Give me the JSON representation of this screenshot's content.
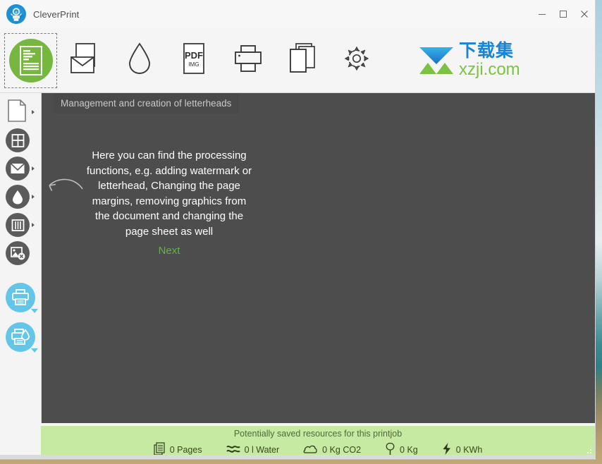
{
  "window": {
    "app_title": "CleverPrint",
    "logo_icon": "cleverprint-logo-icon",
    "controls": {
      "minimize": "–",
      "maximize": "□",
      "close": "✕"
    }
  },
  "toolbar": {
    "items": [
      {
        "name": "letterhead",
        "icon": "letterhead-document-icon",
        "selected": true
      },
      {
        "name": "envelope",
        "icon": "envelope-icon",
        "selected": false
      },
      {
        "name": "watermark",
        "icon": "water-drop-icon",
        "selected": false
      },
      {
        "name": "pdf-img",
        "icon": "pdf-img-icon",
        "label_main": "PDF",
        "label_sub": "IMG",
        "selected": false
      },
      {
        "name": "print",
        "icon": "printer-icon",
        "selected": false
      },
      {
        "name": "copies",
        "icon": "copy-pages-icon",
        "selected": false
      },
      {
        "name": "settings",
        "icon": "gear-icon",
        "selected": false
      }
    ],
    "brand": {
      "icon": "xzji-brand-logo",
      "cn_text": "下载集",
      "domain_text": "xzji.com"
    }
  },
  "sidebar": {
    "items": [
      {
        "name": "page",
        "icon": "page-outline-icon",
        "style": "plain",
        "arrow": true
      },
      {
        "name": "layout",
        "icon": "grid-window-icon",
        "style": "dark",
        "arrow": false
      },
      {
        "name": "envelope",
        "icon": "envelope-circle-icon",
        "style": "dark",
        "arrow": true
      },
      {
        "name": "watermark",
        "icon": "water-drop-circle-icon",
        "style": "dark",
        "arrow": true
      },
      {
        "name": "booklet",
        "icon": "booklet-columns-icon",
        "style": "dark",
        "arrow": true
      },
      {
        "name": "remove-graphics",
        "icon": "image-remove-icon",
        "style": "dark",
        "arrow": false
      },
      {
        "name": "print",
        "icon": "printer-blue-icon",
        "style": "blue",
        "caret": true
      },
      {
        "name": "eco-print",
        "icon": "printer-drop-blue-icon",
        "style": "blue",
        "caret": true
      }
    ]
  },
  "canvas": {
    "tooltip": "Management and creation of letterheads",
    "overlay_text": "Here you can find the processing functions, e.g. adding watermark or letterhead, Changing the page margins, removing graphics from the document and changing the page sheet as well",
    "next_label": "Next",
    "arrow_icon": "curved-arrow-left-icon"
  },
  "statusbar": {
    "title": "Potentially saved resources for this printjob",
    "metrics": [
      {
        "icon": "pages-stack-icon",
        "value": "0 Pages"
      },
      {
        "icon": "water-waves-icon",
        "value": "0 l  Water"
      },
      {
        "icon": "cloud-icon",
        "value": "0 Kg  CO2"
      },
      {
        "icon": "tree-icon",
        "value": "0 Kg"
      },
      {
        "icon": "energy-bolt-icon",
        "value": "0 KWh"
      }
    ],
    "resize_grip_icon": "resize-grip-icon"
  },
  "colors": {
    "accent_green": "#76b73f",
    "accent_blue": "#63c5e8",
    "status_bg": "#c6eaa1",
    "canvas_bg": "#4d4d4d",
    "next_link": "#64b14a"
  }
}
